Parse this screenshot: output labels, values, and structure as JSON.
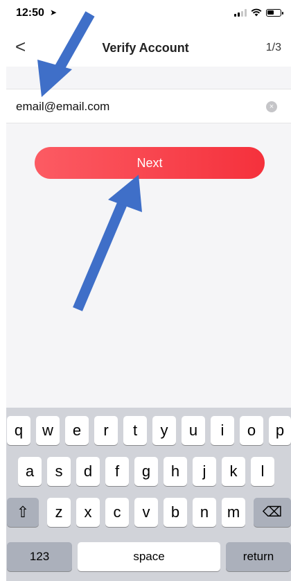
{
  "status_bar": {
    "time": "12:50",
    "location_icon": "location-arrow-icon",
    "signal_icon": "cellular-signal-icon",
    "wifi_icon": "wifi-icon",
    "battery_icon": "battery-icon"
  },
  "nav": {
    "back_glyph": "<",
    "title": "Verify Account",
    "step": "1/3"
  },
  "email_field": {
    "value": "email@email.com",
    "clear_glyph": "×"
  },
  "next_button": {
    "label": "Next",
    "gradient_start": "#fc5b63",
    "gradient_end": "#f5313c"
  },
  "annotations": {
    "arrow_color": "#3f6fc8"
  },
  "keyboard": {
    "row1": [
      "q",
      "w",
      "e",
      "r",
      "t",
      "y",
      "u",
      "i",
      "o",
      "p"
    ],
    "row2": [
      "a",
      "s",
      "d",
      "f",
      "g",
      "h",
      "j",
      "k",
      "l"
    ],
    "row3": [
      "z",
      "x",
      "c",
      "v",
      "b",
      "n",
      "m"
    ],
    "shift_glyph": "⇧",
    "delete_glyph": "⌫",
    "numbers_label": "123",
    "space_label": "space",
    "return_label": "return"
  }
}
